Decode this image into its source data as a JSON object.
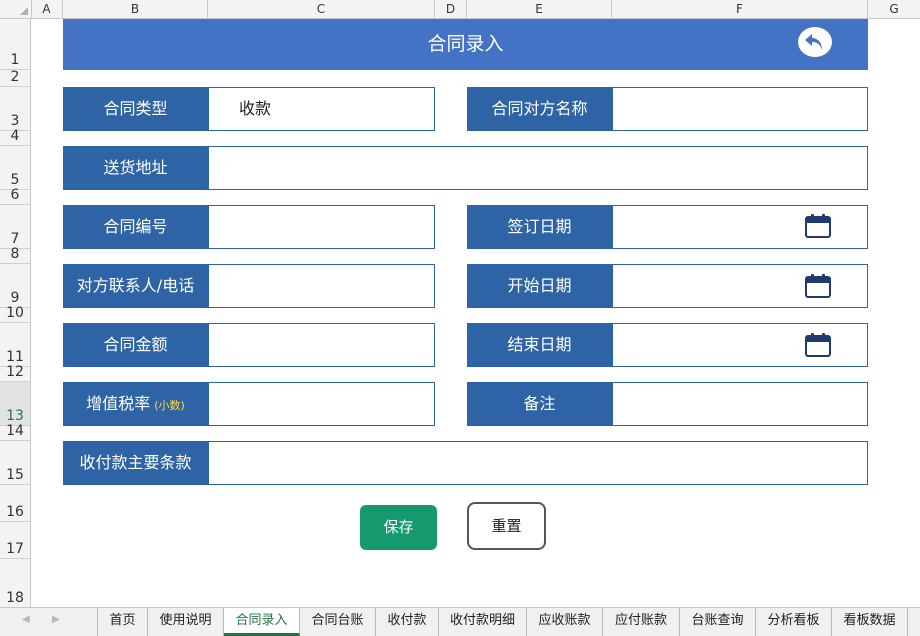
{
  "columns": [
    "A",
    "B",
    "C",
    "D",
    "E",
    "F",
    "G"
  ],
  "rows": [
    "1",
    "2",
    "3",
    "4",
    "5",
    "6",
    "7",
    "8",
    "9",
    "10",
    "11",
    "12",
    "13",
    "14",
    "15",
    "16",
    "17",
    "18"
  ],
  "active_row": "13",
  "form": {
    "title": "合同录入",
    "contract_type_label": "合同类型",
    "contract_type_value": "收款",
    "counterparty_name_label": "合同对方名称",
    "counterparty_name_value": "",
    "delivery_address_label": "送货地址",
    "delivery_address_value": "",
    "contract_number_label": "合同编号",
    "contract_number_value": "",
    "sign_date_label": "签订日期",
    "sign_date_value": "",
    "contact_label": "对方联系人/电话",
    "contact_value": "",
    "start_date_label": "开始日期",
    "start_date_value": "",
    "amount_label": "合同金额",
    "amount_value": "",
    "end_date_label": "结束日期",
    "end_date_value": "",
    "vat_label": "增值税率",
    "vat_note": "(小数)",
    "vat_value": "",
    "remark_label": "备注",
    "remark_value": "",
    "payment_terms_label": "收付款主要条款",
    "payment_terms_value": "",
    "save_label": "保存",
    "reset_label": "重置"
  },
  "tabs": [
    "首页",
    "使用说明",
    "合同录入",
    "合同台账",
    "收付款",
    "收付款明细",
    "应收账款",
    "应付账款",
    "台账查询",
    "分析看板",
    "看板数据"
  ],
  "active_tab": "合同录入",
  "colors": {
    "title_bar": "#4472c4",
    "label_bg": "#2e64a5",
    "save_button": "#16996f",
    "active_tab": "#217346",
    "vat_note": "#ffd84a"
  }
}
